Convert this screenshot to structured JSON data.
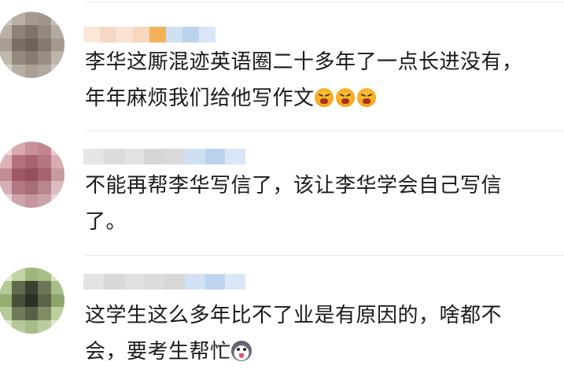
{
  "comments": [
    {
      "text": "李华这厮混迹英语圈二十多年了一点长进没有，年年麻烦我们给他写作文",
      "emoji": [
        "angry-face-icon",
        "angry-face-icon",
        "angry-face-icon"
      ],
      "avatar_colors": [
        "#cfc7bd",
        "#b9b0a6",
        "#a59a8f",
        "#9e958c",
        "#c9c1b8",
        "#bab1a6",
        "#8d8379",
        "#7f7469",
        "#93897e",
        "#b3aba1",
        "#a89d91",
        "#7a6f64",
        "#6e6357",
        "#85796d",
        "#a3998e",
        "#c0b7ad",
        "#958a7f",
        "#887c70",
        "#998e83",
        "#bdb4aa",
        "#d6cfc7",
        "#b6ada3",
        "#a99f94",
        "#b1a89e",
        "#d1cac2"
      ],
      "name_colors": [
        "#fbe6d7",
        "#f6d8c5",
        "#fae3d2",
        "#f9d7be",
        "#f3b25a",
        "#cfe0f3",
        "#bcd3ee",
        "#d8e6f5"
      ]
    },
    {
      "text": "不能再帮李华写信了，该让李华学会自己写信了。",
      "emoji": [],
      "avatar_colors": [
        "#f0d6d8",
        "#d9a9ae",
        "#c8919a",
        "#c1858e",
        "#e9c9cc",
        "#dcb2b7",
        "#b6707c",
        "#a96370",
        "#b27581",
        "#d7abb0",
        "#c58b95",
        "#9d5866",
        "#94505e",
        "#a6636f",
        "#c79aa0",
        "#d7b0b5",
        "#b27983",
        "#a86f79",
        "#b8868e",
        "#dcbcbf",
        "#ecd5d7",
        "#cfa5aa",
        "#c3979d",
        "#caa3a8",
        "#ead2d4"
      ],
      "name_colors": [
        "#e6e6e6",
        "#dcdcdc",
        "#e2e2e2",
        "#d6d6d6",
        "#d9d9d9",
        "#cfe0f3",
        "#bcd3ee",
        "#d8e6f5"
      ]
    },
    {
      "text": "这学生这么多年比不了业是有原因的，啥都不会，要考生帮忙",
      "emoji": [
        "husky-face-icon"
      ],
      "avatar_colors": [
        "#e4ead8",
        "#c5d4a8",
        "#9fb57c",
        "#a7be84",
        "#d7e2c2",
        "#b3c996",
        "#5f6b4a",
        "#3b4030",
        "#6c7656",
        "#a7bd8a",
        "#97ad6f",
        "#48503a",
        "#2c3024",
        "#5a6446",
        "#8ea46a",
        "#b6c99a",
        "#6e7a58",
        "#57614a",
        "#7f8c64",
        "#bcd09c",
        "#dfe8cf",
        "#b7c99b",
        "#a9bd88",
        "#bccc9f",
        "#e0e8d1"
      ],
      "name_colors": [
        "#e3e3e3",
        "#d8d8d8",
        "#e0e0e0",
        "#dcdcdc",
        "#d7d7d7",
        "#d2e2f4",
        "#bfd5ef",
        "#dae7f6"
      ]
    }
  ]
}
